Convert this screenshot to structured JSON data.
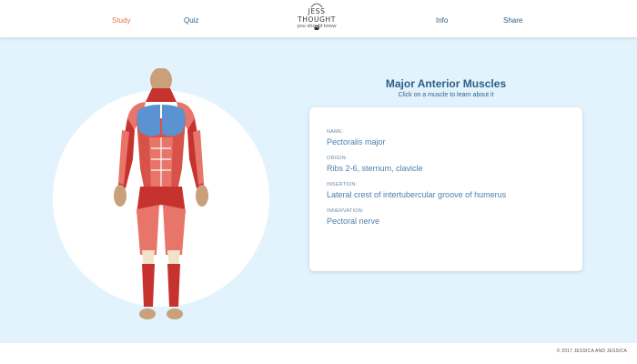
{
  "nav": {
    "study": "Study",
    "quiz": "Quiz",
    "info": "Info",
    "share": "Share"
  },
  "logo": {
    "top": "JESS THOUGHT",
    "bottom": "you should know"
  },
  "main": {
    "heading": "Major Anterior Muscles",
    "subheading": "Click on a muscle to learn about it"
  },
  "details": {
    "name_label": "NAME:",
    "name_value": "Pectoralis major",
    "origin_label": "ORIGIN:",
    "origin_value": "Ribs 2-6, sternum, clavicle",
    "insertion_label": "INSERTION:",
    "insertion_value": "Lateral crest of intertubercular groove of humerus",
    "innervation_label": "INNERVATION:",
    "innervation_value": "Pectoral nerve"
  },
  "footer": {
    "copyright": "© 2017 JESSICA AND JESSICA"
  },
  "colors": {
    "accent": "#e8744f",
    "nav_text": "#2e5f86",
    "background": "#e2f3fd",
    "muscle_red": "#e8756a",
    "muscle_dark": "#c6332f",
    "highlight_blue": "#5b93d1",
    "skin": "#c9a07a"
  }
}
